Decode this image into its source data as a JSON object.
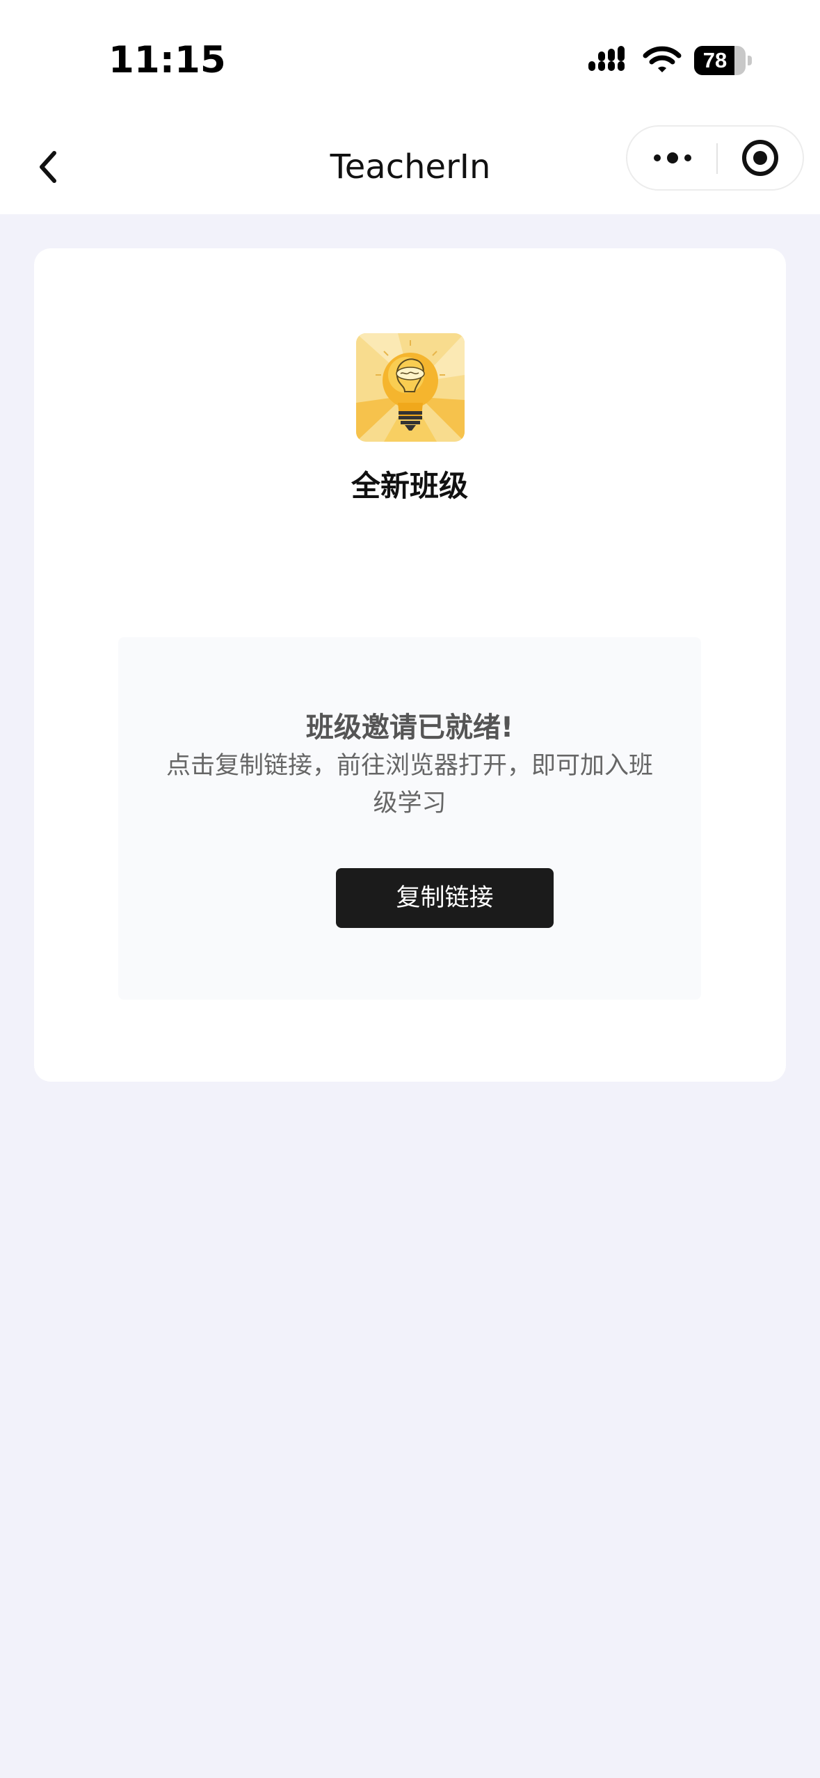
{
  "status_bar": {
    "time": "11:15",
    "battery_percent": "78",
    "battery_level": 0.78,
    "signal_icon": "cellular-signal-icon",
    "wifi_icon": "wifi-icon",
    "battery_icon": "battery-icon"
  },
  "nav": {
    "title": "TeacherIn",
    "back_icon": "chevron-left-icon",
    "more_icon": "more-dots-icon",
    "close_icon": "target-close-icon"
  },
  "card": {
    "logo_icon": "lightbulb-creative-icon",
    "class_name": "全新班级",
    "invite_title": "班级邀请已就绪!",
    "invite_desc": "点击复制链接，前往浏览器打开，即可加入班级学习",
    "copy_button_label": "复制链接"
  },
  "colors": {
    "page_background": "#f2f2fa",
    "card_background": "#ffffff",
    "panel_background": "#f9fafc",
    "button_background": "#1b1b1b",
    "logo_yellow": "#f6c24c"
  }
}
